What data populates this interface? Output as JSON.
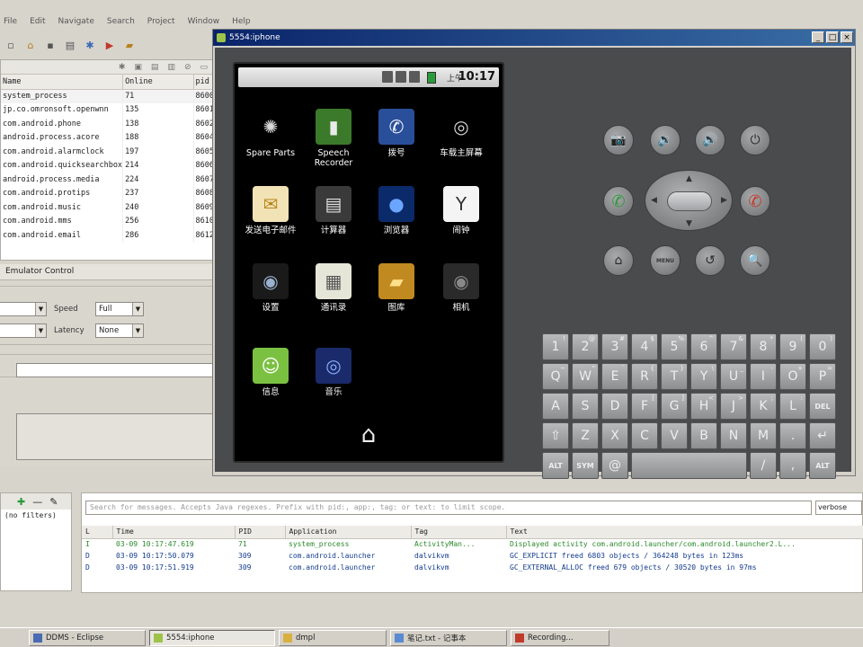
{
  "eclipse": {
    "menu": [
      "File",
      "Edit",
      "Navigate",
      "Search",
      "Project",
      "Window",
      "Help"
    ],
    "toolbar_icons": [
      "new-icon",
      "home-icon",
      "save-icon",
      "print-icon",
      "debug-icon",
      "run-icon",
      "open-folder-icon"
    ],
    "devices": {
      "columns": [
        "Name",
        "Online",
        "pid"
      ],
      "rows": [
        {
          "name": "system_process",
          "online": "71",
          "pid": "8600"
        },
        {
          "name": "jp.co.omronsoft.openwnn",
          "online": "135",
          "pid": "8601"
        },
        {
          "name": "com.android.phone",
          "online": "138",
          "pid": "8602"
        },
        {
          "name": "android.process.acore",
          "online": "188",
          "pid": "8604"
        },
        {
          "name": "com.android.alarmclock",
          "online": "197",
          "pid": "8605"
        },
        {
          "name": "com.android.quicksearchbox",
          "online": "214",
          "pid": "8606"
        },
        {
          "name": "android.process.media",
          "online": "224",
          "pid": "8607"
        },
        {
          "name": "com.android.protips",
          "online": "237",
          "pid": "8608"
        },
        {
          "name": "com.android.music",
          "online": "240",
          "pid": "8609"
        },
        {
          "name": "com.android.mms",
          "online": "256",
          "pid": "8610"
        },
        {
          "name": "com.android.email",
          "online": "286",
          "pid": "8612"
        }
      ]
    },
    "control_tab": "Emulator Control",
    "speed_label": "Speed",
    "speed_value": "Full",
    "latency_label": "Latency",
    "latency_value": "None",
    "logcat": {
      "filter_label": "(no filters)",
      "search_placeholder": "Search for messages. Accepts Java regexes. Prefix with pid:, app:, tag: or text: to limit scope.",
      "level": "verbose",
      "columns": [
        "L",
        "Time",
        "PID",
        "Application",
        "Tag",
        "Text"
      ],
      "rows": [
        {
          "level": "I",
          "time": "03-09 10:17:47.619",
          "pid": "71",
          "app": "system_process",
          "tag": "ActivityMan...",
          "text": "Displayed activity com.android.launcher/com.android.launcher2.L..."
        },
        {
          "level": "D",
          "time": "03-09 10:17:50.079",
          "pid": "309",
          "app": "com.android.launcher",
          "tag": "dalvikvm",
          "text": "GC_EXPLICIT freed 6803 objects / 364248 bytes in 123ms"
        },
        {
          "level": "D",
          "time": "03-09 10:17:51.919",
          "pid": "309",
          "app": "com.android.launcher",
          "tag": "dalvikvm",
          "text": "GC_EXTERNAL_ALLOC freed 679 objects / 30520 bytes in 97ms"
        }
      ]
    }
  },
  "emulator": {
    "title": "5554:iphone",
    "status": {
      "ampm": "上午",
      "time": "10:17"
    },
    "apps": [
      {
        "label": "Spare Parts",
        "icon": "gear-icon",
        "bg": "#000000",
        "fg": "#d8d8d8"
      },
      {
        "label": "Speech Recorder",
        "icon": "microphone-icon",
        "bg": "#3b7a2a",
        "fg": "#eaeaea"
      },
      {
        "label": "拨号",
        "icon": "phone-icon",
        "bg": "#2a4f9a",
        "fg": "#ffffff"
      },
      {
        "label": "车载主屏幕",
        "icon": "steering-wheel-icon",
        "bg": "#000000",
        "fg": "#d8d8d8"
      },
      {
        "label": "发送电子邮件",
        "icon": "mail-icon",
        "bg": "#f2e3b6",
        "fg": "#b8861a"
      },
      {
        "label": "计算器",
        "icon": "calculator-icon",
        "bg": "#3a3a3a",
        "fg": "#e0e0e0"
      },
      {
        "label": "浏览器",
        "icon": "globe-icon",
        "bg": "#0a2a6a",
        "fg": "#6aa6ff"
      },
      {
        "label": "闹钟",
        "icon": "clock-icon",
        "bg": "#f4f4f4",
        "fg": "#333333"
      },
      {
        "label": "设置",
        "icon": "settings-icon",
        "bg": "#1a1a1a",
        "fg": "#9ab0d0"
      },
      {
        "label": "通讯录",
        "icon": "contacts-icon",
        "bg": "#e6e6d8",
        "fg": "#555555"
      },
      {
        "label": "图库",
        "icon": "gallery-icon",
        "bg": "#c08a20",
        "fg": "#ffe08a"
      },
      {
        "label": "相机",
        "icon": "camera-lens-icon",
        "bg": "#2a2a2a",
        "fg": "#888888"
      },
      {
        "label": "信息",
        "icon": "message-icon",
        "bg": "#7ac142",
        "fg": "#ffffff"
      },
      {
        "label": "音乐",
        "icon": "speaker-icon",
        "bg": "#1a2a6a",
        "fg": "#8ab0ff"
      }
    ],
    "hardware": {
      "camera": "📷",
      "vol_down": "🔉",
      "vol_up": "🔊",
      "power": "⏻",
      "call": "✆",
      "end": "✆",
      "home": "⌂",
      "menu": "MENU",
      "back": "↺",
      "search": "🔍"
    },
    "keyboard": {
      "row1": [
        [
          "1",
          "!"
        ],
        [
          "2",
          "@"
        ],
        [
          "3",
          "#"
        ],
        [
          "4",
          "$"
        ],
        [
          "5",
          "%"
        ],
        [
          "6",
          "^"
        ],
        [
          "7",
          "&"
        ],
        [
          "8",
          "*"
        ],
        [
          "9",
          "("
        ],
        [
          "0",
          ")"
        ]
      ],
      "row2": [
        [
          "Q",
          "~"
        ],
        [
          "W",
          "\""
        ],
        [
          "E",
          "`"
        ],
        [
          "R",
          "{"
        ],
        [
          "T",
          "}"
        ],
        [
          "Y",
          "\\"
        ],
        [
          "U",
          "_"
        ],
        [
          "I",
          "-"
        ],
        [
          "O",
          "+"
        ],
        [
          "P",
          "="
        ]
      ],
      "row3": [
        [
          "A",
          ""
        ],
        [
          "S",
          ""
        ],
        [
          "D",
          ""
        ],
        [
          "F",
          "["
        ],
        [
          "G",
          "]"
        ],
        [
          "H",
          "<"
        ],
        [
          "J",
          ">"
        ],
        [
          "K",
          ";"
        ],
        [
          "L",
          ":"
        ],
        [
          "DEL",
          ""
        ]
      ],
      "row4": [
        [
          "⇧",
          ""
        ],
        [
          "Z",
          ""
        ],
        [
          "X",
          ""
        ],
        [
          "C",
          ""
        ],
        [
          "V",
          ""
        ],
        [
          "B",
          ""
        ],
        [
          "N",
          ""
        ],
        [
          "M",
          ""
        ],
        [
          ".",
          ""
        ],
        [
          "↵",
          ""
        ]
      ],
      "row5_alt_left": "ALT",
      "row5_sym": "SYM",
      "row5_at": "@",
      "row5_slash": "/",
      "row5_comma": ",",
      "row5_alt_right": "ALT"
    }
  },
  "taskbar": [
    {
      "label": "DDMS - Eclipse",
      "active": false
    },
    {
      "label": "5554:iphone",
      "active": true
    },
    {
      "label": "dmpl",
      "active": false
    },
    {
      "label": "笔记.txt - 记事本",
      "active": false
    },
    {
      "label": "Recording...",
      "active": false
    }
  ]
}
